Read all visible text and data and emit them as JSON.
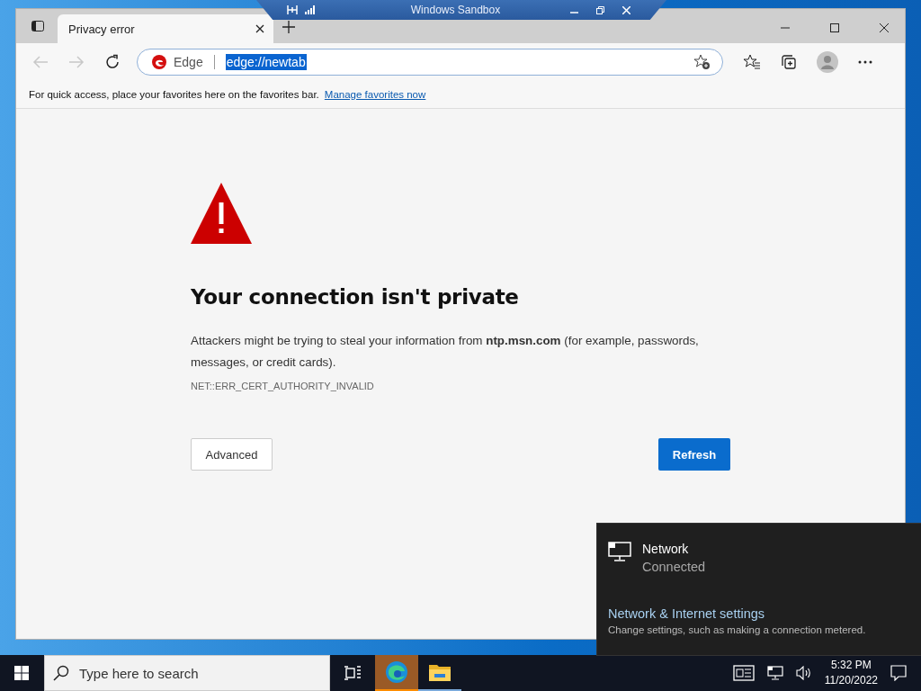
{
  "sandbox_bar": {
    "title": "Windows Sandbox"
  },
  "tabs": [
    {
      "label": "Privacy error",
      "selected": true
    }
  ],
  "address_bar": {
    "site_label": "Edge",
    "url": "edge://newtab",
    "url_selected": true
  },
  "favorites_bar": {
    "message": "For quick access, place your favorites here on the favorites bar.",
    "link": "Manage favorites now"
  },
  "error_page": {
    "title": "Your connection isn't private",
    "message": "Attackers might be trying to steal your information from **ntp.msn.com** (for example, passwords, messages, or credit cards).",
    "error_code": "NET::ERR_CERT_AUTHORITY_INVALID",
    "buttons": [
      {
        "label": "Advanced",
        "kind": "secondary"
      },
      {
        "label": "Refresh",
        "kind": "primary"
      }
    ]
  },
  "network_flyout": {
    "name": "Network",
    "status": "Connected",
    "settings_link": "Network & Internet settings",
    "settings_hint": "Change settings, such as making a connection metered."
  },
  "taskbar": {
    "search": {
      "placeholder": "Type here to search"
    },
    "apps": [
      {
        "kind": "edge",
        "selected": true
      },
      {
        "kind": "folder",
        "selected": false
      }
    ],
    "clock": {
      "time": "5:32 PM",
      "date": "11/20/2022"
    }
  }
}
